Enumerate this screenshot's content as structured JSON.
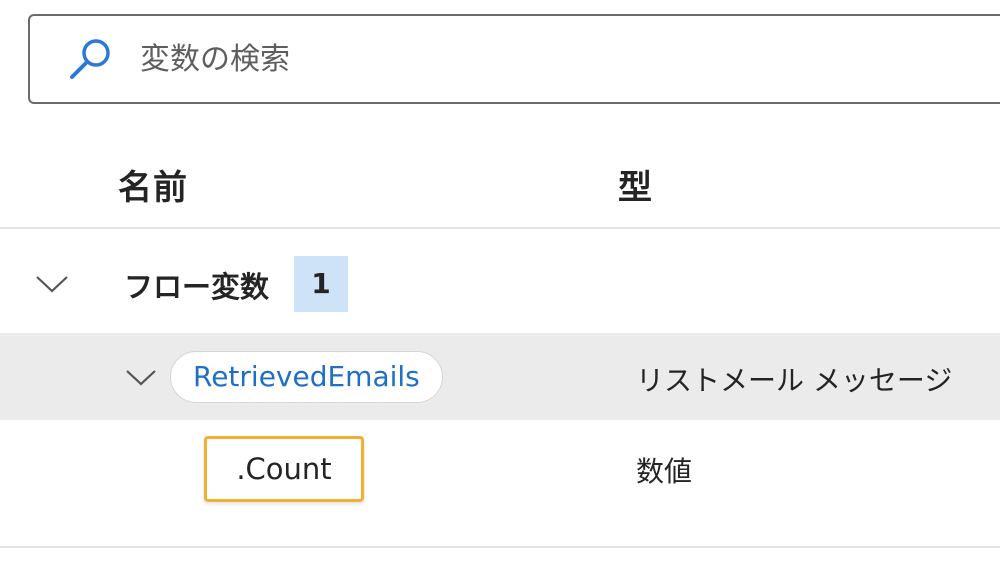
{
  "search": {
    "placeholder": "変数の検索",
    "value": ""
  },
  "columns": {
    "name": "名前",
    "type": "型"
  },
  "groups": [
    {
      "label": "フロー変数",
      "count": "1",
      "expanded": true,
      "variables": [
        {
          "name": "RetrievedEmails",
          "type": "リストメール メッセージ",
          "expanded": true,
          "properties": [
            {
              "name": ".Count",
              "type": "数値",
              "highlighted": true
            }
          ]
        }
      ]
    }
  ],
  "colors": {
    "accent_text": "#1f6fc6",
    "count_badge_bg": "#cfe3f8",
    "selected_row_bg": "#ebebeb",
    "highlight_border": "#f0b132",
    "search_icon": "#2b79d6"
  },
  "icons": {
    "search": "search-icon",
    "group_toggle": "chevron-down-icon",
    "variable_toggle": "chevron-down-icon"
  }
}
